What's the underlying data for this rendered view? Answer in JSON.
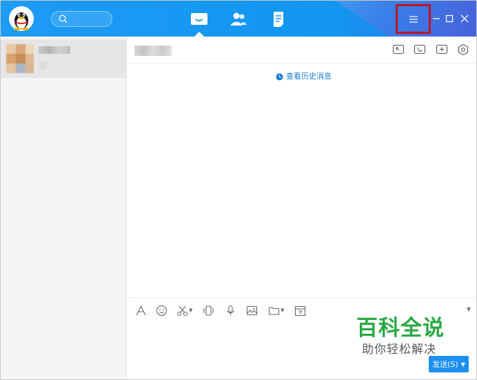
{
  "titlebar": {
    "nav_tabs": [
      {
        "icon": "chat-icon",
        "active": true
      },
      {
        "icon": "contacts-icon",
        "active": false
      },
      {
        "icon": "notes-icon",
        "active": false
      }
    ],
    "brand_color": "#1296f0",
    "highlight_color": "#c0141c"
  },
  "chat": {
    "history_link": "查看历史消息"
  },
  "toolbar": {
    "icons": [
      "font-icon",
      "emoji-icon",
      "scissors-icon",
      "shake-icon",
      "microphone-icon",
      "image-icon",
      "folder-icon",
      "calendar-icon"
    ]
  },
  "watermark": {
    "title": "百科全说",
    "subtitle": "助你轻松解决"
  },
  "send_button": {
    "label": "发送(S)"
  }
}
